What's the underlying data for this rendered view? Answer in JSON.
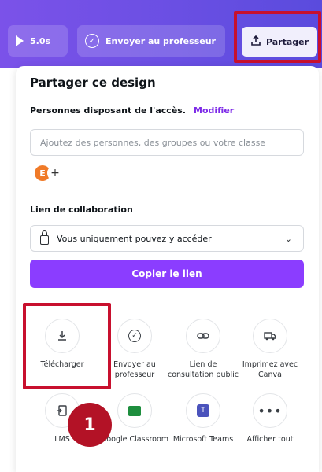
{
  "toolbar": {
    "play_label": "5.0s",
    "send_label": "Envoyer au professeur",
    "share_label": "Partager"
  },
  "panel": {
    "title": "Partager ce design",
    "access_label": "Personnes disposant de l'accès.",
    "access_edit": "Modifier",
    "people_placeholder": "Ajoutez des personnes, des groupes ou votre classe",
    "avatar_initial": "E",
    "add_symbol": "+",
    "collab_label": "Lien de collaboration",
    "collab_access": "Vous uniquement pouvez y accéder",
    "copy_link": "Copier le lien"
  },
  "options": [
    {
      "label": "Télécharger",
      "icon": "download-icon"
    },
    {
      "label": "Envoyer au professeur",
      "icon": "check-circle-icon"
    },
    {
      "label": "Lien de consultation public",
      "icon": "link-icon"
    },
    {
      "label": "Imprimez avec Canva",
      "icon": "truck-icon"
    },
    {
      "label": "LMS",
      "icon": "lms-icon"
    },
    {
      "label": "Google Classroom",
      "icon": "google-classroom-icon"
    },
    {
      "label": "Microsoft Teams",
      "icon": "teams-icon"
    },
    {
      "label": "Afficher tout",
      "icon": "more-icon"
    }
  ],
  "annotation": {
    "step_number": "1"
  },
  "colors": {
    "accent": "#8b3dff",
    "highlight": "#c8102e",
    "toolbar": "#6a4fe3"
  }
}
